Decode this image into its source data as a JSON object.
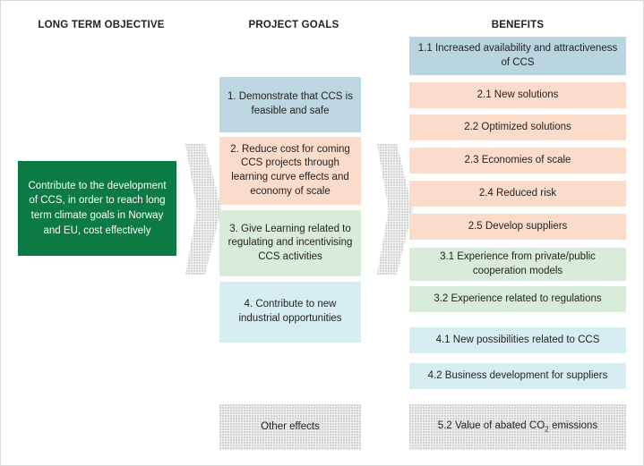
{
  "diagram": {
    "title": "CCS project objective, goals and benefits logic chart",
    "columns": [
      {
        "id": "objective",
        "heading": "LONG TERM OBJECTIVE"
      },
      {
        "id": "goals",
        "heading": "PROJECT GOALS"
      },
      {
        "id": "benefits",
        "heading": "BENEFITS"
      }
    ],
    "objective": {
      "text": "Contribute to the development of CCS, in order to reach long term climate goals in Norway and EU, cost effectively",
      "color": "#0b7a45",
      "text_color": "#ffffff"
    },
    "arrows": [
      {
        "id": "arrow-objective-to-goals",
        "direction": "right",
        "color": "#f2f2f2",
        "style": "dotted-fill"
      },
      {
        "id": "arrow-goals-to-benefits",
        "direction": "right",
        "color": "#f2f2f2",
        "style": "dotted-fill"
      }
    ],
    "goals": [
      {
        "id": "goal-1",
        "text": "1. Demonstrate that CCS is feasible and safe",
        "color": "#bcd6e2"
      },
      {
        "id": "goal-2",
        "text": "2. Reduce cost for coming CCS projects through learning curve effects and economy of scale",
        "color": "#fbdccb"
      },
      {
        "id": "goal-3",
        "text": "3. Give Learning related to regulating and incentivising CCS activities",
        "color": "#d9ebd9"
      },
      {
        "id": "goal-4",
        "text": "4. Contribute to new industrial opportunities",
        "color": "#d6edf2"
      },
      {
        "id": "goal-other",
        "text": "Other effects",
        "color": "#f1f1f1"
      }
    ],
    "benefits": [
      {
        "id": "benefit-1-1",
        "text": "1.1 Increased availability and attractiveness of CCS",
        "color": "#b8d5e0"
      },
      {
        "id": "benefit-2-1",
        "text": "2.1 New solutions",
        "color": "#fbdccb"
      },
      {
        "id": "benefit-2-2",
        "text": "2.2 Optimized solutions",
        "color": "#fbdccb"
      },
      {
        "id": "benefit-2-3",
        "text": "2.3 Economies of scale",
        "color": "#fbdccb"
      },
      {
        "id": "benefit-2-4",
        "text": "2.4 Reduced risk",
        "color": "#fbdccb"
      },
      {
        "id": "benefit-2-5",
        "text": "2.5 Develop suppliers",
        "color": "#fbdccb"
      },
      {
        "id": "benefit-3-1",
        "text": "3.1 Experience from private/public cooperation models",
        "color": "#d9ebd9"
      },
      {
        "id": "benefit-3-2",
        "text": "3.2 Experience related to regulations",
        "color": "#d9ebd9"
      },
      {
        "id": "benefit-4-1",
        "text": "4.1 New possibilities related to CCS",
        "color": "#d6edf2"
      },
      {
        "id": "benefit-4-2",
        "text": "4.2 Business development for suppliers",
        "color": "#d6edf2"
      },
      {
        "id": "benefit-5-2",
        "text_prefix": "5.2 Value of abated CO",
        "text_subscript": "2",
        "text_suffix": " emissions",
        "color": "#f1f1f1"
      }
    ]
  }
}
